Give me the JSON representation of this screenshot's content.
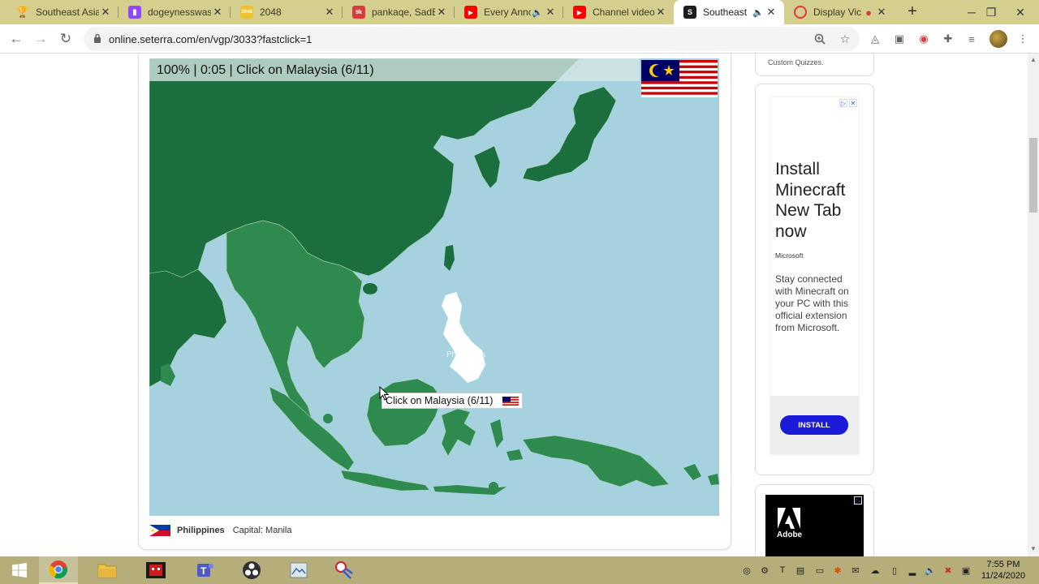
{
  "browser": {
    "tabs": [
      {
        "title": "Southeast Asia:",
        "icon": "trophy-icon",
        "color": "#e8a317"
      },
      {
        "title": "dogeynesswast",
        "icon": "twitch-icon",
        "color": "#9146ff"
      },
      {
        "title": "2048",
        "icon": "2048-icon",
        "color": "#edc22e"
      },
      {
        "title": "pankaqe, SadB",
        "icon": "9k-icon",
        "color": "#d93b3b"
      },
      {
        "title": "Every Annc",
        "icon": "youtube-icon",
        "color": "#ff0000"
      },
      {
        "title": "Channel videos",
        "icon": "youtube-icon",
        "color": "#ff0000"
      },
      {
        "title": "Southeast",
        "icon": "seterra-icon",
        "color": "#1d1d1d"
      },
      {
        "title": "Display Vic",
        "icon": "record-icon",
        "color": "#d93b3b"
      }
    ],
    "url": "online.seterra.com/en/vgp/3033?fastclick=1"
  },
  "game": {
    "hud": "100%  |  0:05  |  Click on Malaysia (6/11)",
    "hover_label": "Click on Malaysia (6/11)",
    "ghost_label": "Philippines",
    "info_country": "Philippines",
    "info_capital": "Capital: Manila"
  },
  "ads": {
    "top_snippet": "Custom Quizzes.",
    "headline": "Install Minecraft New Tab now",
    "source": "Microsoft",
    "body": "Stay connected with Minecraft on your PC with this official extension from Microsoft.",
    "cta": "INSTALL",
    "second_brand": "Adobe"
  },
  "taskbar": {
    "time": "7:55 PM",
    "date": "11/24/2020"
  },
  "colors": {
    "land": "#1b6e3d",
    "sea_land": "#2e8a4e",
    "water": "#a6d1df",
    "accent": "#1a1ad8"
  }
}
